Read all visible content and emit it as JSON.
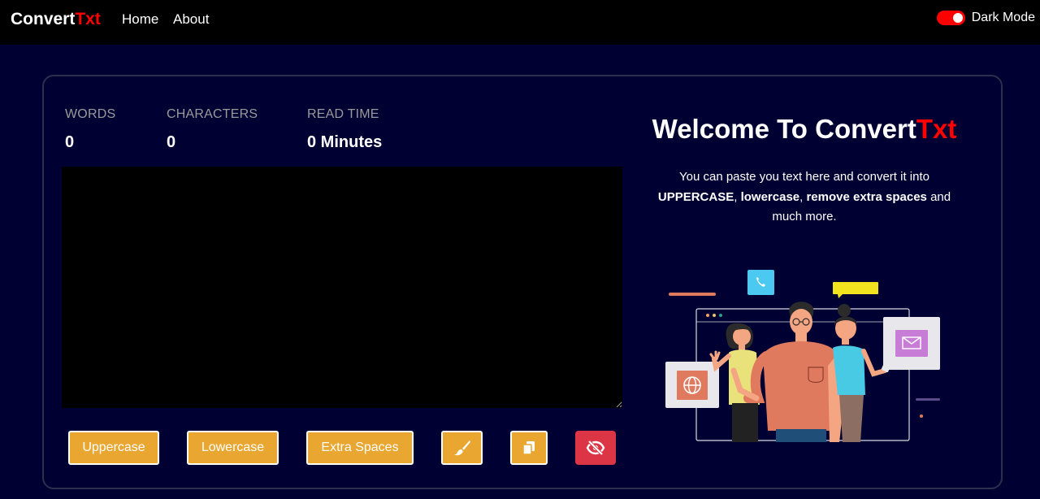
{
  "navbar": {
    "brand_main": "Convert",
    "brand_accent": "Txt",
    "links": [
      "Home",
      "About"
    ],
    "dark_mode_label": "Dark Mode",
    "dark_mode_on": true
  },
  "stats": {
    "words_label": "WORDS",
    "words_value": "0",
    "characters_label": "CHARACTERS",
    "characters_value": "0",
    "read_time_label": "READ TIME",
    "read_time_value": "0 Minutes"
  },
  "editor": {
    "value": "",
    "placeholder": ""
  },
  "buttons": {
    "uppercase": "Uppercase",
    "lowercase": "Lowercase",
    "extra_spaces": "Extra Spaces"
  },
  "welcome": {
    "title_main": "Welcome To Convert",
    "title_accent": "Txt",
    "desc_part1": "You can paste you text here and convert it into ",
    "desc_bold1": "UPPERCASE",
    "desc_sep1": ", ",
    "desc_bold2": "lowercase",
    "desc_sep2": ", ",
    "desc_bold3": "remove extra spaces",
    "desc_part2": " and much more."
  },
  "icons": {
    "clear": "brush-icon",
    "copy": "copy-icon",
    "hide": "eye-slash-icon"
  },
  "colors": {
    "background": "#000033",
    "navbar": "#000000",
    "accent_red": "#ff0000",
    "button_orange": "#e9a630",
    "button_red": "#dc3545",
    "editor_bg": "#000000"
  }
}
